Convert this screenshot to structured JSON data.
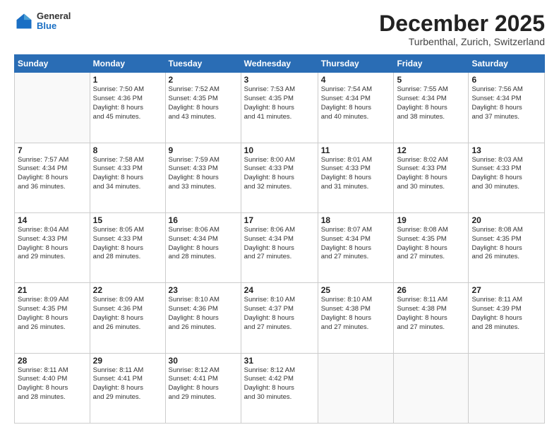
{
  "header": {
    "logo": {
      "general": "General",
      "blue": "Blue"
    },
    "title": "December 2025",
    "location": "Turbenthal, Zurich, Switzerland"
  },
  "weekdays": [
    "Sunday",
    "Monday",
    "Tuesday",
    "Wednesday",
    "Thursday",
    "Friday",
    "Saturday"
  ],
  "weeks": [
    [
      {
        "day": "",
        "info": ""
      },
      {
        "day": "1",
        "info": "Sunrise: 7:50 AM\nSunset: 4:36 PM\nDaylight: 8 hours\nand 45 minutes."
      },
      {
        "day": "2",
        "info": "Sunrise: 7:52 AM\nSunset: 4:35 PM\nDaylight: 8 hours\nand 43 minutes."
      },
      {
        "day": "3",
        "info": "Sunrise: 7:53 AM\nSunset: 4:35 PM\nDaylight: 8 hours\nand 41 minutes."
      },
      {
        "day": "4",
        "info": "Sunrise: 7:54 AM\nSunset: 4:34 PM\nDaylight: 8 hours\nand 40 minutes."
      },
      {
        "day": "5",
        "info": "Sunrise: 7:55 AM\nSunset: 4:34 PM\nDaylight: 8 hours\nand 38 minutes."
      },
      {
        "day": "6",
        "info": "Sunrise: 7:56 AM\nSunset: 4:34 PM\nDaylight: 8 hours\nand 37 minutes."
      }
    ],
    [
      {
        "day": "7",
        "info": "Sunrise: 7:57 AM\nSunset: 4:34 PM\nDaylight: 8 hours\nand 36 minutes."
      },
      {
        "day": "8",
        "info": "Sunrise: 7:58 AM\nSunset: 4:33 PM\nDaylight: 8 hours\nand 34 minutes."
      },
      {
        "day": "9",
        "info": "Sunrise: 7:59 AM\nSunset: 4:33 PM\nDaylight: 8 hours\nand 33 minutes."
      },
      {
        "day": "10",
        "info": "Sunrise: 8:00 AM\nSunset: 4:33 PM\nDaylight: 8 hours\nand 32 minutes."
      },
      {
        "day": "11",
        "info": "Sunrise: 8:01 AM\nSunset: 4:33 PM\nDaylight: 8 hours\nand 31 minutes."
      },
      {
        "day": "12",
        "info": "Sunrise: 8:02 AM\nSunset: 4:33 PM\nDaylight: 8 hours\nand 30 minutes."
      },
      {
        "day": "13",
        "info": "Sunrise: 8:03 AM\nSunset: 4:33 PM\nDaylight: 8 hours\nand 30 minutes."
      }
    ],
    [
      {
        "day": "14",
        "info": "Sunrise: 8:04 AM\nSunset: 4:33 PM\nDaylight: 8 hours\nand 29 minutes."
      },
      {
        "day": "15",
        "info": "Sunrise: 8:05 AM\nSunset: 4:33 PM\nDaylight: 8 hours\nand 28 minutes."
      },
      {
        "day": "16",
        "info": "Sunrise: 8:06 AM\nSunset: 4:34 PM\nDaylight: 8 hours\nand 28 minutes."
      },
      {
        "day": "17",
        "info": "Sunrise: 8:06 AM\nSunset: 4:34 PM\nDaylight: 8 hours\nand 27 minutes."
      },
      {
        "day": "18",
        "info": "Sunrise: 8:07 AM\nSunset: 4:34 PM\nDaylight: 8 hours\nand 27 minutes."
      },
      {
        "day": "19",
        "info": "Sunrise: 8:08 AM\nSunset: 4:35 PM\nDaylight: 8 hours\nand 27 minutes."
      },
      {
        "day": "20",
        "info": "Sunrise: 8:08 AM\nSunset: 4:35 PM\nDaylight: 8 hours\nand 26 minutes."
      }
    ],
    [
      {
        "day": "21",
        "info": "Sunrise: 8:09 AM\nSunset: 4:35 PM\nDaylight: 8 hours\nand 26 minutes."
      },
      {
        "day": "22",
        "info": "Sunrise: 8:09 AM\nSunset: 4:36 PM\nDaylight: 8 hours\nand 26 minutes."
      },
      {
        "day": "23",
        "info": "Sunrise: 8:10 AM\nSunset: 4:36 PM\nDaylight: 8 hours\nand 26 minutes."
      },
      {
        "day": "24",
        "info": "Sunrise: 8:10 AM\nSunset: 4:37 PM\nDaylight: 8 hours\nand 27 minutes."
      },
      {
        "day": "25",
        "info": "Sunrise: 8:10 AM\nSunset: 4:38 PM\nDaylight: 8 hours\nand 27 minutes."
      },
      {
        "day": "26",
        "info": "Sunrise: 8:11 AM\nSunset: 4:38 PM\nDaylight: 8 hours\nand 27 minutes."
      },
      {
        "day": "27",
        "info": "Sunrise: 8:11 AM\nSunset: 4:39 PM\nDaylight: 8 hours\nand 28 minutes."
      }
    ],
    [
      {
        "day": "28",
        "info": "Sunrise: 8:11 AM\nSunset: 4:40 PM\nDaylight: 8 hours\nand 28 minutes."
      },
      {
        "day": "29",
        "info": "Sunrise: 8:11 AM\nSunset: 4:41 PM\nDaylight: 8 hours\nand 29 minutes."
      },
      {
        "day": "30",
        "info": "Sunrise: 8:12 AM\nSunset: 4:41 PM\nDaylight: 8 hours\nand 29 minutes."
      },
      {
        "day": "31",
        "info": "Sunrise: 8:12 AM\nSunset: 4:42 PM\nDaylight: 8 hours\nand 30 minutes."
      },
      {
        "day": "",
        "info": ""
      },
      {
        "day": "",
        "info": ""
      },
      {
        "day": "",
        "info": ""
      }
    ]
  ]
}
